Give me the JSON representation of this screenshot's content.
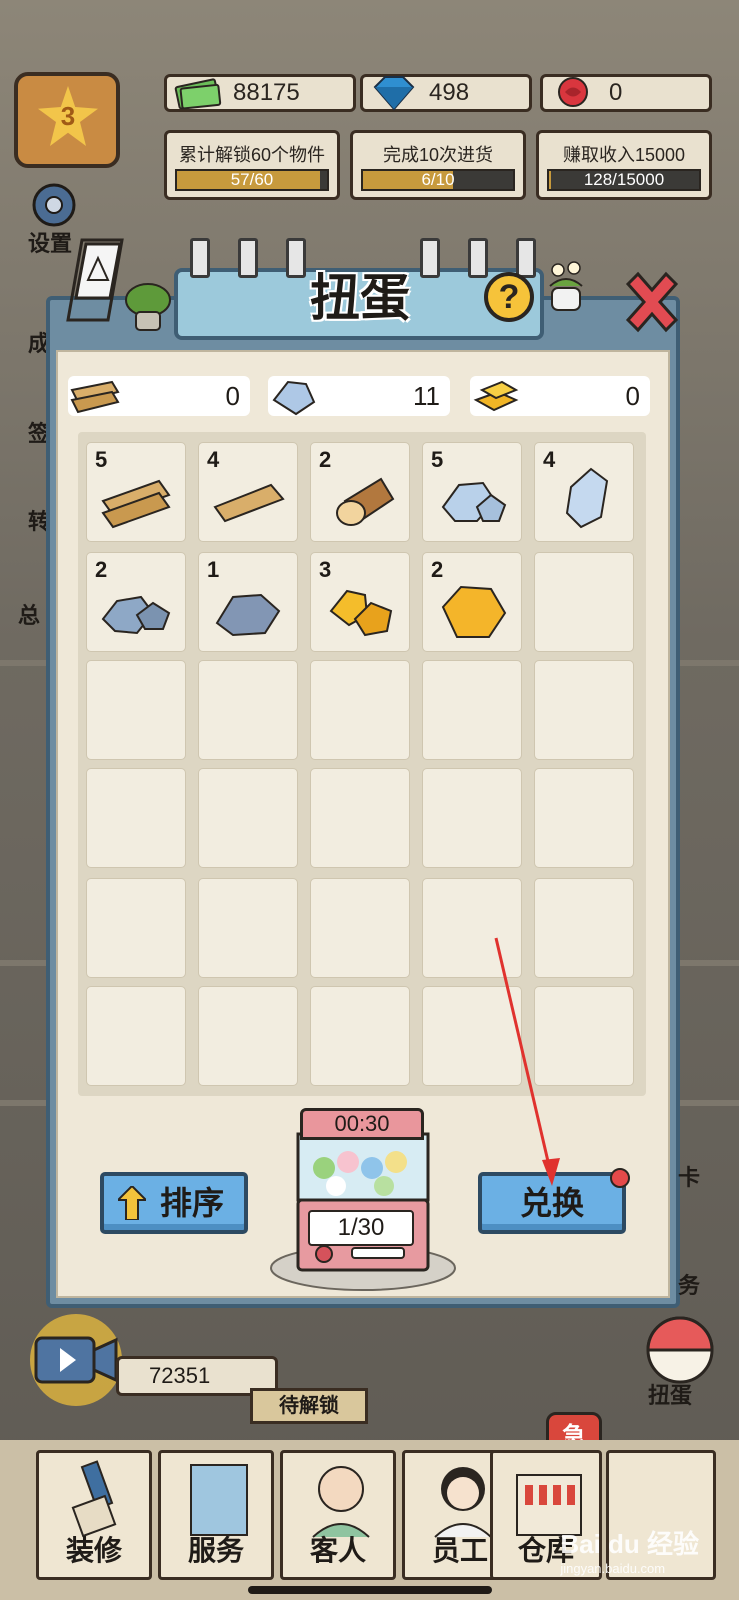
{
  "hud": {
    "level": "3",
    "cash": "88175",
    "diamonds": "498",
    "roses": "0",
    "tasks": [
      {
        "label": "累计解锁60个物件",
        "progress": "57/60",
        "fraction": 0.95
      },
      {
        "label": "完成10次进货",
        "progress": "6/10",
        "fraction": 0.6
      },
      {
        "label": "赚取收入15000",
        "progress": "128/15000",
        "fraction": 0.0085
      }
    ],
    "side_left": [
      "设置",
      "成",
      "签",
      "转",
      "总"
    ]
  },
  "panel": {
    "title": "扭蛋",
    "resources": [
      {
        "icon": "wood-plank-icon",
        "value": "0"
      },
      {
        "icon": "stone-icon",
        "value": "11"
      },
      {
        "icon": "gold-bar-icon",
        "value": "0"
      }
    ],
    "items": [
      {
        "count": "5",
        "icon": "double-plank-icon"
      },
      {
        "count": "4",
        "icon": "single-plank-icon"
      },
      {
        "count": "2",
        "icon": "log-icon"
      },
      {
        "count": "5",
        "icon": "silver-rock-pile-icon"
      },
      {
        "count": "4",
        "icon": "silver-crystal-icon"
      },
      {
        "count": "2",
        "icon": "grey-rock-pile-icon"
      },
      {
        "count": "1",
        "icon": "grey-rock-icon"
      },
      {
        "count": "3",
        "icon": "gold-ore-pile-icon"
      },
      {
        "count": "2",
        "icon": "gold-nugget-icon"
      }
    ],
    "sort_label": "排序",
    "exchange_label": "兑换",
    "timer": "00:30",
    "counter": "1/30"
  },
  "bottom": {
    "video_reward": "72351",
    "locked": "待解锁",
    "urgent": "急",
    "gacha_side": "扭蛋",
    "side_right": [
      "卡",
      "务"
    ],
    "nav": [
      "装修",
      "服务",
      "客人",
      "员工",
      "仓库"
    ],
    "watermark": "Bai du 经验",
    "watermark_sub": "jingyan.baidu.com"
  }
}
